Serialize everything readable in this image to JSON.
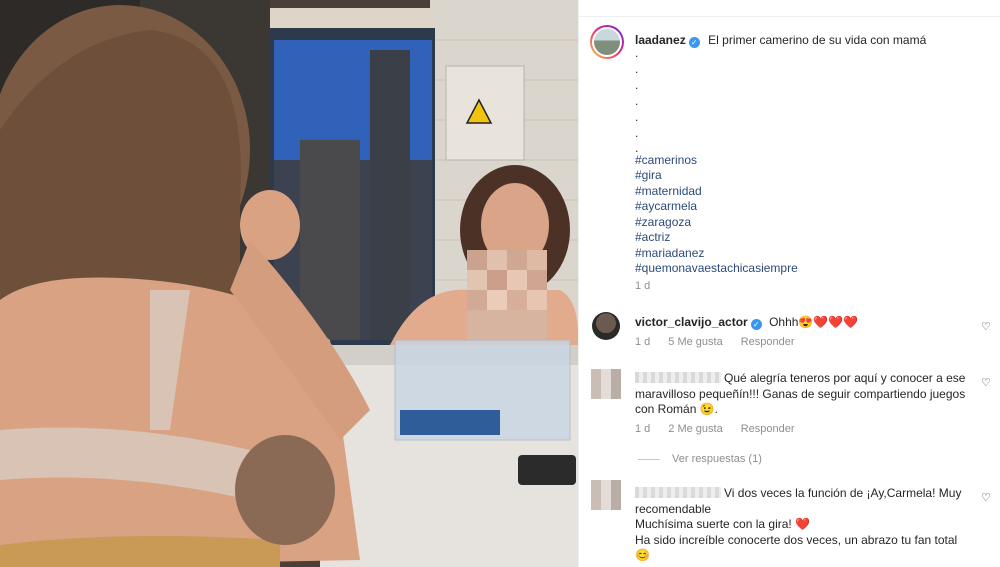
{
  "post": {
    "author": "laadanez",
    "caption_title": "El primer camerino de su vida con mamá",
    "caption_dots": [
      ".",
      ".",
      ".",
      ".",
      ".",
      ".",
      "."
    ],
    "hashtags": [
      "#camerinos",
      "#gira",
      "#maternidad",
      "#aycarmela",
      "#zaragoza",
      "#actriz",
      "#mariadanez",
      "#quemonavaestachicasiempre"
    ],
    "age": "1 d"
  },
  "comments": [
    {
      "author": "victor_clavijo_actor",
      "text": "Ohhh😍",
      "hearts": "❤️❤️❤️",
      "age": "1 d",
      "likes": "5 Me gusta",
      "reply": "Responder"
    },
    {
      "text_line1": "Qué alegría teneros por aquí y conocer a ese",
      "text_line2": "maravilloso pequeñín!!! Ganas de seguir compartiendo juegos",
      "text_line3": "con Román 😉.",
      "age": "1 d",
      "likes": "2 Me gusta",
      "reply": "Responder",
      "view_replies": "Ver respuestas (1)"
    },
    {
      "text_line1": "Vi dos veces la función de ¡Ay,Carmela! Muy",
      "text_line2": "recomendable",
      "text_line3": "Muchísima suerte con la gira!",
      "text_line3_heart": "❤️",
      "text_line4": "Ha sido increíble conocerte dos veces, un abrazo tu fan total",
      "text_line5": "😊"
    }
  ],
  "icons": {
    "like": "heart-outline-icon",
    "verified": "verified-badge-icon"
  },
  "colors": {
    "text": "#262626",
    "muted": "#8e8e8e",
    "verified": "#3897f0",
    "heart": "#ed4956"
  }
}
